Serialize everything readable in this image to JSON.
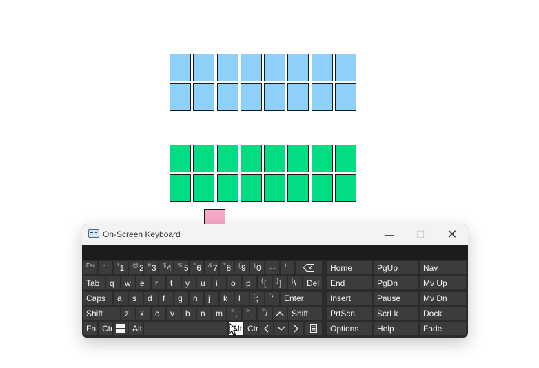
{
  "window": {
    "title": "On-Screen Keyboard",
    "minimize_glyph": "—",
    "maximize_glyph": "☐",
    "close_glyph": "✕"
  },
  "grids": {
    "blue_cells": 16,
    "green_cells": 16
  },
  "colors": {
    "blue": "#8fd0fb",
    "green": "#00dd82",
    "pink": "#f7a8c8",
    "osk_bg": "#2b2b2b",
    "key_bg": "#3c3c3c"
  },
  "keys": {
    "esc": "Esc",
    "tilde_sup": "~",
    "tilde": "`",
    "k1_sup": "!",
    "k1": "1",
    "k2_sup": "@",
    "k2": "2",
    "k3_sup": "#",
    "k3": "3",
    "k4_sup": "$",
    "k4": "4",
    "k5_sup": "%",
    "k5": "5",
    "k6_sup": "^",
    "k6": "6",
    "k7_sup": "&",
    "k7": "7",
    "k8_sup": "*",
    "k8": "8",
    "k9_sup": "(",
    "k9": "9",
    "k0_sup": ")",
    "k0": "0",
    "minus_sup": "_",
    "minus": "-",
    "equals_sup": "+",
    "equals": "=",
    "tab": "Tab",
    "q": "q",
    "w": "w",
    "e": "e",
    "r": "r",
    "t": "t",
    "y": "y",
    "u": "u",
    "i": "i",
    "o": "o",
    "p": "p",
    "lbracket_sup": "{",
    "lbracket": "[",
    "rbracket_sup": "}",
    "rbracket": "]",
    "backslash_sup": "|",
    "backslash": "\\",
    "del": "Del",
    "caps": "Caps",
    "a": "a",
    "s": "s",
    "d": "d",
    "f": "f",
    "g": "g",
    "h": "h",
    "j": "j",
    "k": "k",
    "l": "l",
    "semicolon_sup": ":",
    "semicolon": ";",
    "quote_sup": "\"",
    "quote": "'",
    "enter": "Enter",
    "shift": "Shift",
    "z": "z",
    "x": "x",
    "c": "c",
    "v": "v",
    "b": "b",
    "n": "n",
    "m": "m",
    "comma_sup": "<",
    "comma": ",",
    "period_sup": ">",
    "period": ".",
    "slash_sup": "?",
    "slash": "/",
    "fn": "Fn",
    "ctrl": "Ctrl",
    "alt": "Alt",
    "alt_right": "Alt",
    "ctrl_right": "Ctrl"
  },
  "right_keys": {
    "home": "Home",
    "pgup": "PgUp",
    "nav": "Nav",
    "end": "End",
    "pgdn": "PgDn",
    "mvup": "Mv Up",
    "insert": "Insert",
    "pause": "Pause",
    "mvdn": "Mv Dn",
    "prtscn": "PrtScn",
    "scrlk": "ScrLk",
    "dock": "Dock",
    "options": "Options",
    "help": "Help",
    "fade": "Fade"
  }
}
